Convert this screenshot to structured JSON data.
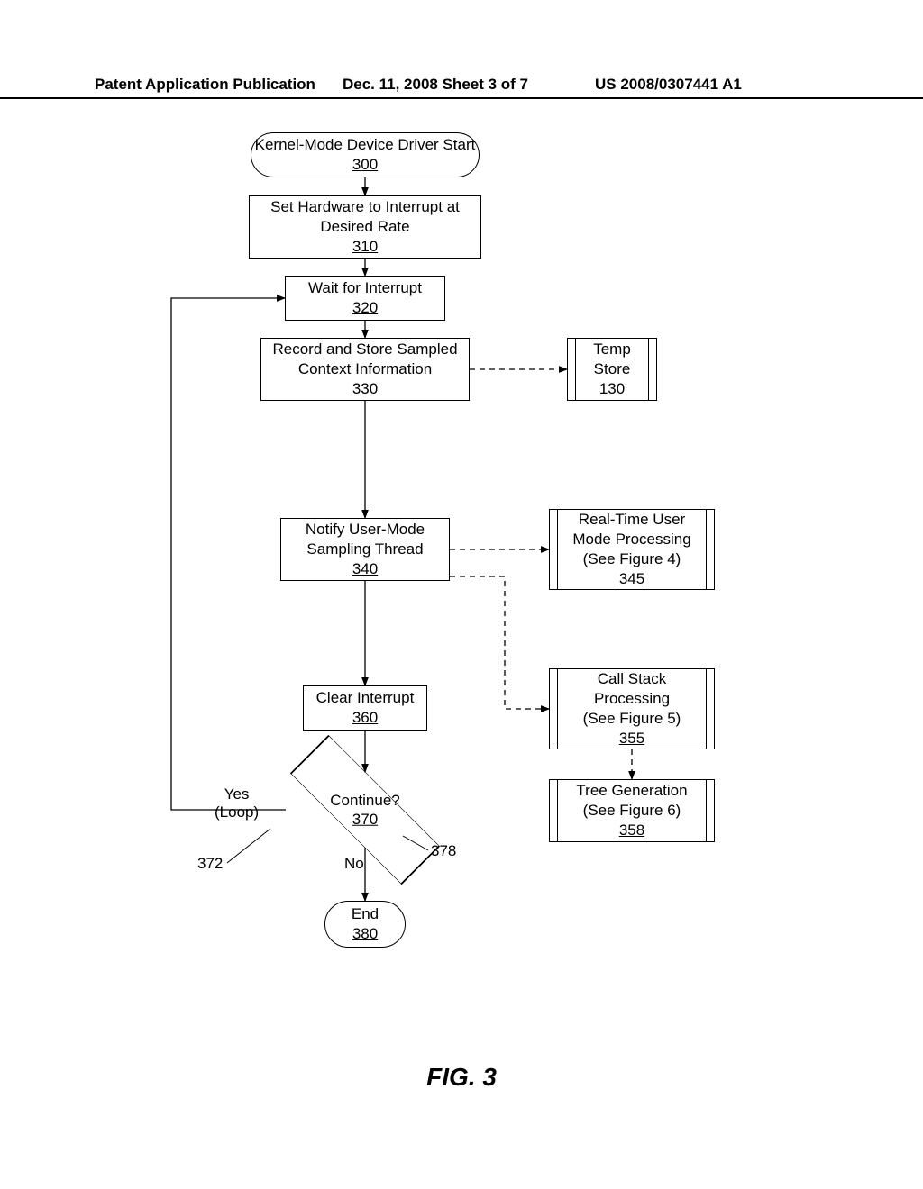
{
  "header": {
    "left": "Patent Application Publication",
    "mid": "Dec. 11, 2008  Sheet 3 of 7",
    "right": "US 2008/0307441 A1"
  },
  "figure": "FIG. 3",
  "nodes": {
    "start": {
      "text": "Kernel-Mode Device Driver Start",
      "ref": "300"
    },
    "setHW": {
      "text_l1": "Set Hardware to Interrupt at",
      "text_l2": "Desired Rate",
      "ref": "310"
    },
    "wait": {
      "text": "Wait for Interrupt",
      "ref": "320"
    },
    "record": {
      "text_l1": "Record and Store Sampled",
      "text_l2": "Context Information",
      "ref": "330"
    },
    "temp": {
      "text_l1": "Temp",
      "text_l2": "Store",
      "ref": "130"
    },
    "notify": {
      "text_l1": "Notify User-Mode",
      "text_l2": "Sampling Thread",
      "ref": "340"
    },
    "realtime": {
      "text_l1": "Real-Time User",
      "text_l2": "Mode Processing",
      "text_l3": "(See Figure 4)",
      "ref": "345"
    },
    "clear": {
      "text": "Clear Interrupt",
      "ref": "360"
    },
    "callstack": {
      "text_l1": "Call Stack",
      "text_l2": "Processing",
      "text_l3": "(See Figure 5)",
      "ref": "355"
    },
    "tree": {
      "text_l1": "Tree Generation",
      "text_l2": "(See Figure 6)",
      "ref": "358"
    },
    "decision": {
      "text": "Continue?",
      "ref": "370"
    },
    "end": {
      "text": "End",
      "ref": "380"
    }
  },
  "labels": {
    "yes": "Yes",
    "loop": "(Loop)",
    "no": "No",
    "ref372": "372",
    "ref378": "378"
  }
}
